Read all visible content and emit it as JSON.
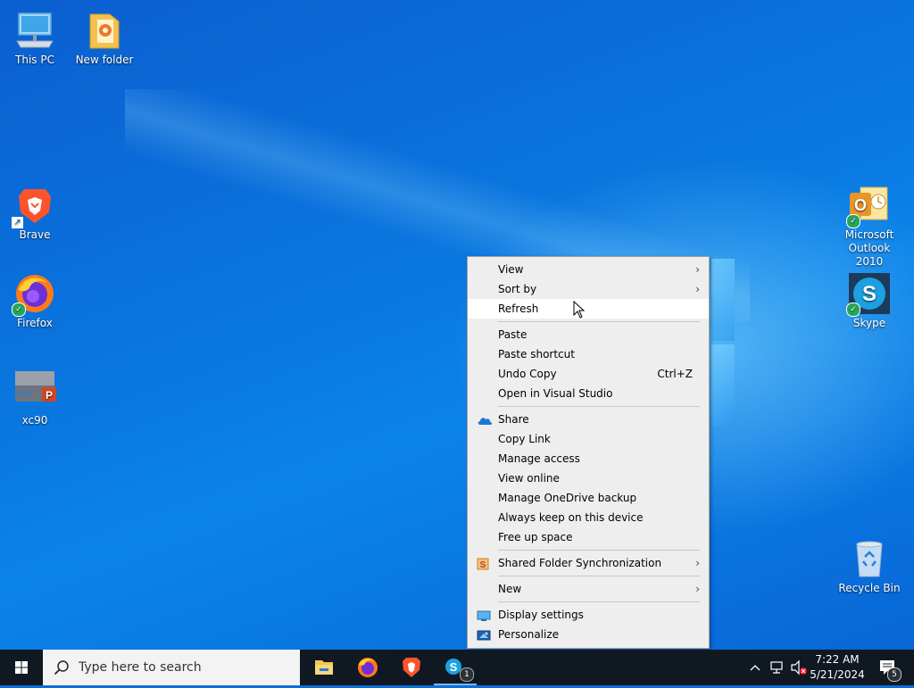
{
  "desktop": {
    "icons": [
      {
        "label": "This PC"
      },
      {
        "label": "New folder"
      },
      {
        "label": "Brave"
      },
      {
        "label": "Firefox"
      },
      {
        "label": "xc90"
      },
      {
        "label": "Microsoft Outlook 2010"
      },
      {
        "label": "Skype"
      },
      {
        "label": "Recycle Bin"
      }
    ]
  },
  "context_menu": {
    "items": {
      "view": "View",
      "sort_by": "Sort by",
      "refresh": "Refresh",
      "paste": "Paste",
      "paste_shortcut": "Paste shortcut",
      "undo_copy": "Undo Copy",
      "undo_copy_shortcut": "Ctrl+Z",
      "open_in_visual_studio": "Open in Visual Studio",
      "share": "Share",
      "copy_link": "Copy Link",
      "manage_access": "Manage access",
      "view_online": "View online",
      "manage_onedrive_backup": "Manage OneDrive backup",
      "always_keep": "Always keep on this device",
      "free_up_space": "Free up space",
      "shared_folder_sync": "Shared Folder Synchronization",
      "new": "New",
      "display_settings": "Display settings",
      "personalize": "Personalize"
    }
  },
  "taskbar": {
    "search_placeholder": "Type here to search",
    "skype_badge": "1",
    "notification_count": "5",
    "time": "7:22 AM",
    "date": "5/21/2024"
  },
  "colors": {
    "accent": "#0078d7",
    "taskbar_bg": "#101822",
    "menu_bg": "#eeeeee"
  },
  "icon_names": [
    "windows-start-icon",
    "search-icon",
    "file-explorer-icon",
    "firefox-icon",
    "brave-icon",
    "skype-icon",
    "chevron-up-icon",
    "network-icon",
    "volume-muted-icon",
    "notification-icon"
  ]
}
